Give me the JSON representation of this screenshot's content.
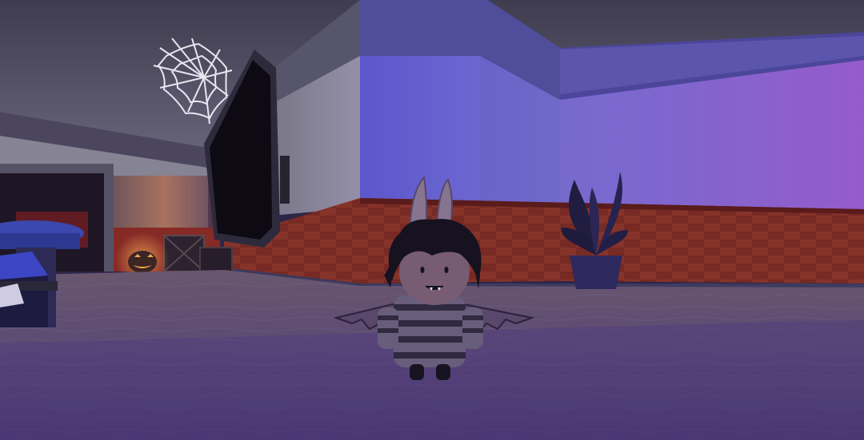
{
  "scene": {
    "kind": "3d-game-viewport",
    "hud_text": []
  },
  "colors": {
    "ceiling": "#4a4a58",
    "wall_lavender": "#6a62c8",
    "wall_purple": "#8c58c8",
    "wainscot_red": "#7a2616",
    "floor": "#5a4a68",
    "pumpkin_glow": "#e88a2a"
  },
  "icons": [
    "cobweb-icon",
    "jack-o-lantern-icon",
    "potted-plant-icon"
  ]
}
